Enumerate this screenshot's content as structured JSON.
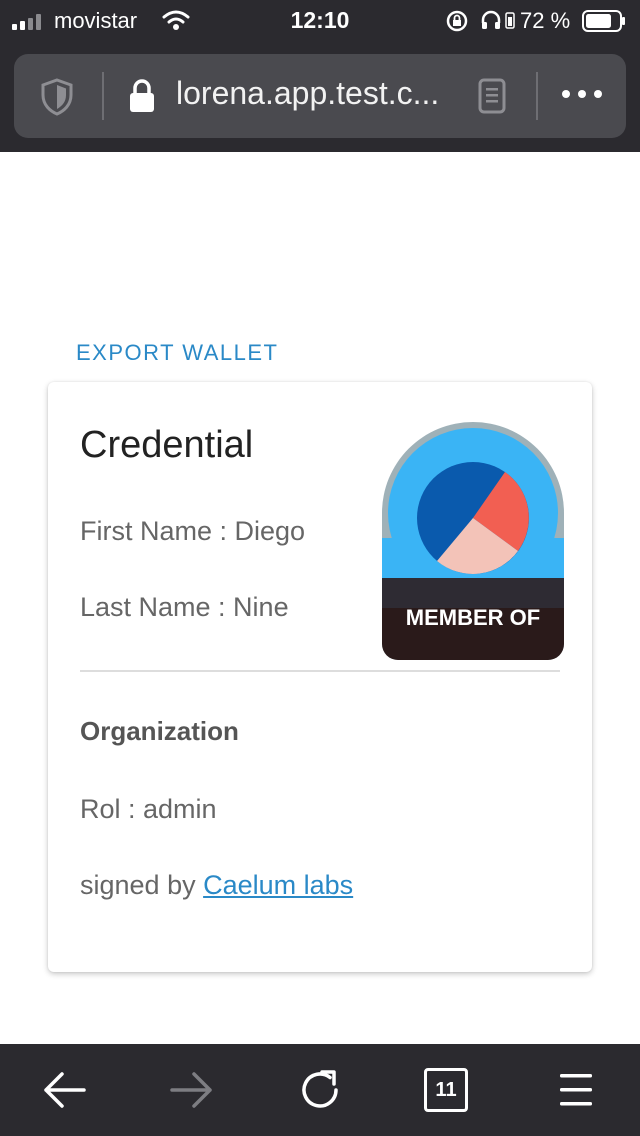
{
  "status_bar": {
    "carrier": "movistar",
    "time": "12:10",
    "battery_percent": "72 %"
  },
  "browser": {
    "url": "lorena.app.test.c...",
    "tab_count": "11"
  },
  "page": {
    "export_link": "EXPORT WALLET",
    "card": {
      "title": "Credential",
      "first_name": "First Name : Diego",
      "last_name": "Last Name : Nine",
      "badge_text": "MEMBER OF",
      "organization_heading": "Organization",
      "role": "Rol : admin",
      "signed_by_prefix": "signed by ",
      "signed_by_link": "Caelum labs"
    }
  },
  "colors": {
    "accent": "#2a89c7",
    "badge_sky": "#3ab4f5",
    "badge_dark": "#2e2b33",
    "badge_bottom": "#2a1a1a",
    "pie_blue": "#0a5aad",
    "pie_red": "#f25f52",
    "pie_pink": "#f3c3b8"
  },
  "icons": [
    "signal-icon",
    "wifi-icon",
    "orientation-lock-icon",
    "headphones-icon",
    "battery-icon",
    "shield-icon",
    "lock-icon",
    "reader-icon",
    "more-icon",
    "back-icon",
    "forward-icon",
    "reload-icon",
    "tabs-icon",
    "menu-icon"
  ]
}
